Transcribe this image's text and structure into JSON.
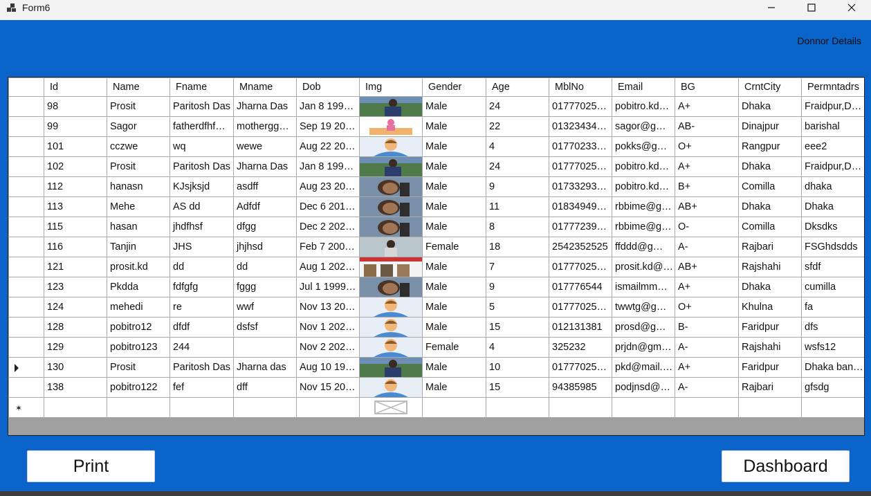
{
  "window": {
    "title": "Form6",
    "header_label": "Donnor Details",
    "buttons": {
      "print": "Print",
      "dashboard": "Dashboard"
    }
  },
  "grid": {
    "columns": [
      "Id",
      "Name",
      "Fname",
      "Mname",
      "Dob",
      "Img",
      "Gender",
      "Age",
      "MblNo",
      "Email",
      "BG",
      "CrntCity",
      "Permntadrs"
    ],
    "current_row_index": 13,
    "rows": [
      {
        "id": "98",
        "name": "Prosit",
        "fname": "Paritosh Das",
        "mname": "Jharna Das",
        "dob": "Jan  8 199…",
        "img": "photo-man-outdoor",
        "gender": "Male",
        "age": "24",
        "mbl": "017770259…",
        "email": "pobitro.kd…",
        "bg": "A+",
        "city": "Dhaka",
        "perm": "Fraidpur,D…"
      },
      {
        "id": "99",
        "name": "Sagor",
        "fname": "fatherdfhf…",
        "mname": "mothergg…",
        "dob": "Sep 19 20…",
        "img": "illustration-person",
        "gender": "Male",
        "age": "22",
        "mbl": "013234343…",
        "email": "sagor@g…",
        "bg": "AB-",
        "city": "Dinajpur",
        "perm": "barishal"
      },
      {
        "id": "101",
        "name": " cczwe",
        "fname": "wq",
        "mname": "wewe",
        "dob": "Aug 22 20…",
        "img": "avatar-placeholder",
        "gender": "Male",
        "age": "4",
        "mbl": "017702332…",
        "email": "pokks@g…",
        "bg": "O+",
        "city": "Rangpur",
        "perm": "eee2"
      },
      {
        "id": "102",
        "name": "Prosit",
        "fname": "Paritosh Das",
        "mname": "Jharna Das",
        "dob": "Jan  8 199…",
        "img": "photo-man-outdoor",
        "gender": "Male",
        "age": "24",
        "mbl": "017770259…",
        "email": "pobitro.kd…",
        "bg": "A+",
        "city": "Dhaka",
        "perm": "Fraidpur,D…"
      },
      {
        "id": "112",
        "name": "hanasn",
        "fname": "KJsjksjd",
        "mname": "asdff",
        "dob": "Aug 23 20…",
        "img": "photo-man-selfie",
        "gender": "Male",
        "age": "9",
        "mbl": "017332938…",
        "email": "pobitro.kd…",
        "bg": "B+",
        "city": "Comilla",
        "perm": "dhaka"
      },
      {
        "id": "113",
        "name": "Mehe",
        "fname": "AS dd",
        "mname": "Adfdf",
        "dob": "Dec  6 201…",
        "img": "photo-man-selfie",
        "gender": "Male",
        "age": "11",
        "mbl": "018349493…",
        "email": "rbbime@g…",
        "bg": "AB+",
        "city": "Dhaka",
        "perm": "Dhaka"
      },
      {
        "id": "115",
        "name": "hasan",
        "fname": "jhdfhsf",
        "mname": "dfgg",
        "dob": "Dec  2 202…",
        "img": "photo-man-selfie",
        "gender": "Male",
        "age": "8",
        "mbl": "017772392…",
        "email": "rbbime@g…",
        "bg": "O-",
        "city": "Comilla",
        "perm": "Dksdks"
      },
      {
        "id": "116",
        "name": "Tanjin",
        "fname": "JHS",
        "mname": "jhjhsd",
        "dob": "Feb  7 200…",
        "img": "photo-woman",
        "gender": "Female",
        "age": "18",
        "mbl": "2542352525",
        "email": "ffddd@g…",
        "bg": "A-",
        "city": "Rajbari",
        "perm": "FSGhdsdds"
      },
      {
        "id": "121",
        "name": "prosit.kd",
        "fname": "dd",
        "mname": "dd",
        "dob": "Aug  1 202…",
        "img": "photo-banner",
        "gender": "Male",
        "age": "7",
        "mbl": "017770259…",
        "email": "prosit.kd@…",
        "bg": "AB+",
        "city": "Rajshahi",
        "perm": "sfdf"
      },
      {
        "id": "123",
        "name": "Pkdda",
        "fname": "fdfgfg",
        "mname": "fggg",
        "dob": "Jul  1 1999…",
        "img": "photo-man-selfie",
        "gender": "Male",
        "age": "9",
        "mbl": "017776544",
        "email": "ismailmm…",
        "bg": "A+",
        "city": "Dhaka",
        "perm": "cumilla"
      },
      {
        "id": "124",
        "name": "mehedi",
        "fname": "re",
        "mname": "wwf",
        "dob": "Nov 13 20…",
        "img": "avatar-placeholder",
        "gender": "Male",
        "age": "5",
        "mbl": "017770259…",
        "email": "twwtg@g…",
        "bg": "O+",
        "city": "Khulna",
        "perm": "fa"
      },
      {
        "id": "128",
        "name": "pobitro12",
        "fname": "dfdf",
        "mname": "dsfsf",
        "dob": "Nov  1 202…",
        "img": "avatar-placeholder",
        "gender": "Male",
        "age": "15",
        "mbl": "012131381",
        "email": "prosd@g…",
        "bg": "B-",
        "city": "Faridpur",
        "perm": "dfs"
      },
      {
        "id": "129",
        "name": "pobitro123",
        "fname": "244",
        "mname": "",
        "dob": "Nov  2 202…",
        "img": "avatar-placeholder",
        "gender": "Female",
        "age": "4",
        "mbl": "325232",
        "email": "prjdn@gm…",
        "bg": "A-",
        "city": "Rajshahi",
        "perm": "wsfs12"
      },
      {
        "id": "130",
        "name": "Prosit",
        "fname": "Paritosh Das",
        "mname": "Jharna das",
        "dob": "Aug 10 19…",
        "img": "photo-man-outdoor",
        "gender": "Male",
        "age": "10",
        "mbl": "017770259…",
        "email": "pkd@mail.…",
        "bg": "A+",
        "city": "Faridpur",
        "perm": "Dhaka ban…"
      },
      {
        "id": "138",
        "name": "pobitro122",
        "fname": "fef",
        "mname": "dff",
        "dob": "Nov 15 20…",
        "img": "avatar-placeholder",
        "gender": "Male",
        "age": "15",
        "mbl": "94385985",
        "email": "podjnsd@…",
        "bg": "A-",
        "city": "Rajbari",
        "perm": "gfsdg"
      }
    ]
  },
  "colors": {
    "window_bg": "#0a64c9",
    "titlebar_bg": "#f3f3f3",
    "grid_empty_bg": "#a0a0a0"
  }
}
